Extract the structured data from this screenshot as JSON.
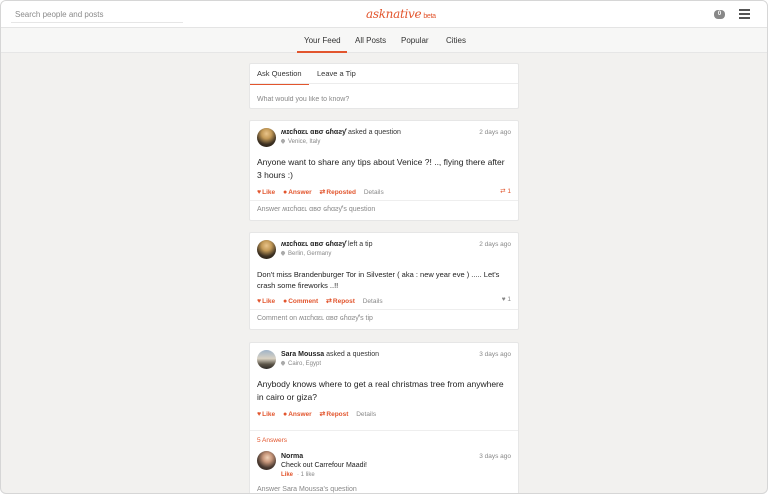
{
  "header": {
    "search_placeholder": "Search people and posts",
    "logo": "asknative",
    "logo_beta": "beta",
    "notification_count": "0"
  },
  "nav": {
    "tabs": [
      {
        "label": "Your Feed",
        "active": true
      },
      {
        "label": "All Posts"
      },
      {
        "label": "Popular"
      },
      {
        "label": "Cities"
      }
    ]
  },
  "composer": {
    "tabs": [
      {
        "label": "Ask Question",
        "active": true
      },
      {
        "label": "Leave a Tip"
      }
    ],
    "placeholder": "What would you like to know?"
  },
  "posts": [
    {
      "user": "ʍɪcɦαεʟ αвσ ɢɦαƨƴ",
      "action": "asked a question",
      "location": "Venice, Italy",
      "time": "2 days ago",
      "text": "Anyone want to share any tips about Venice ?! .., flying there after 3 hours :)",
      "actions": [
        "Like",
        "Answer",
        "Reposted",
        "Details"
      ],
      "count": "1",
      "count_icon": "repost-icon",
      "reply": "Answer ʍɪcɦαεʟ αвσ ɢɦαƨƴ's question"
    },
    {
      "user": "ʍɪcɦαεʟ αвσ ɢɦαƨƴ",
      "action": "left a tip",
      "location": "Berlin, Germany",
      "time": "2 days ago",
      "text": "Don't miss Brandenburger Tor in Silvester ( aka : new year eve ) ..... Let's crash some fireworks ..!!",
      "actions": [
        "Like",
        "Comment",
        "Repost",
        "Details"
      ],
      "count": "1",
      "count_icon": "heart-icon",
      "reply": "Comment on ʍɪcɦαεʟ αвσ ɢɦαƨƴ's tip"
    },
    {
      "user": "Sara Moussa",
      "action": "asked a question",
      "location": "Cairo, Egypt",
      "time": "3 days ago",
      "text": "Anybody knows where to get a real christmas tree from anywhere in cairo or giza?",
      "actions": [
        "Like",
        "Answer",
        "Repost",
        "Details"
      ],
      "answers_label": "5 Answers",
      "answer": {
        "user": "Norma",
        "time": "3 days ago",
        "text": "Check out Carrefour Maadi!",
        "like": "Like",
        "likes": "· 1 like"
      },
      "reply": "Answer Sara Moussa's question"
    }
  ],
  "colors": {
    "accent": "#e2552d",
    "background": "#f2f1ef"
  }
}
